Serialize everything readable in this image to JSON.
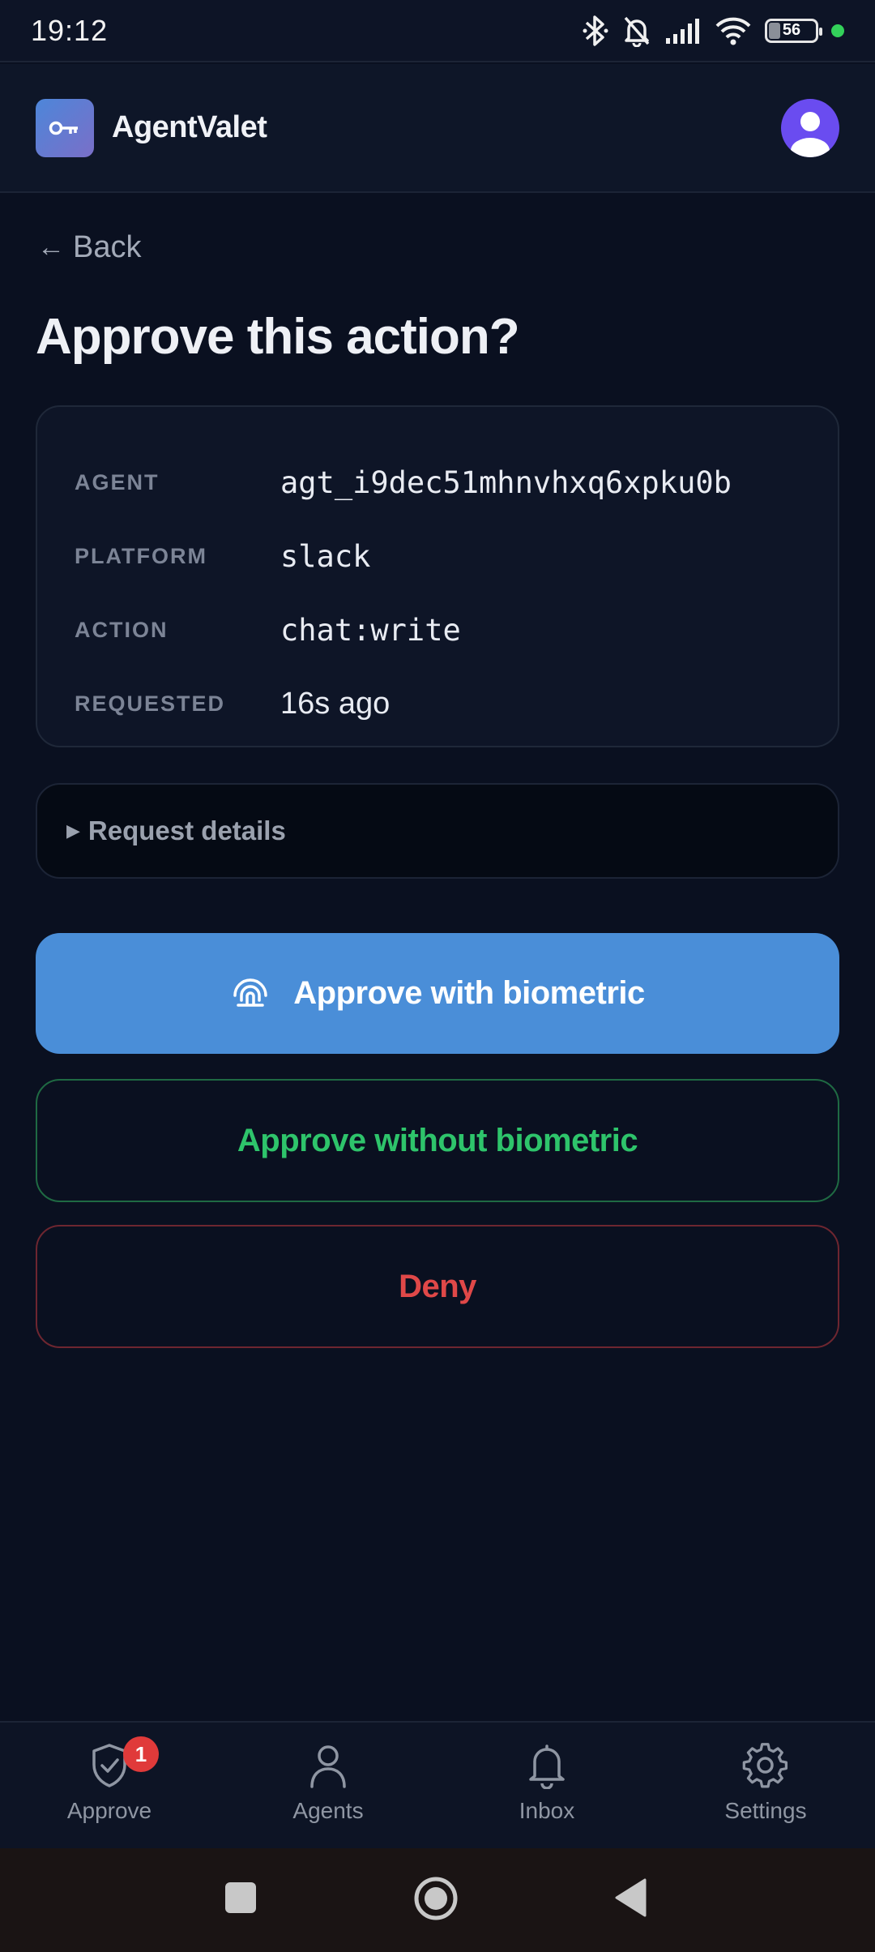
{
  "status_bar": {
    "time": "19:12",
    "battery": "56",
    "icons": [
      "bluetooth-icon",
      "bell-muted-icon",
      "signal-icon",
      "wifi-icon",
      "battery-icon",
      "dot-icon"
    ]
  },
  "header": {
    "app_name": "AgentValet",
    "logo_icon": "key-icon",
    "avatar_icon": "user-avatar-icon"
  },
  "back": {
    "arrow": "←",
    "label": "Back"
  },
  "page": {
    "title": "Approve this action?"
  },
  "request": {
    "rows": [
      {
        "label": "AGENT",
        "value": "agt_i9dec51mhnvhxq6xpku0b",
        "mono": true
      },
      {
        "label": "PLATFORM",
        "value": "slack",
        "mono": true
      },
      {
        "label": "ACTION",
        "value": "chat:write",
        "mono": true
      },
      {
        "label": "REQUESTED",
        "value": "16s ago",
        "mono": false
      }
    ]
  },
  "details": {
    "toggle": "▶",
    "label": "Request details"
  },
  "actions": {
    "approve_biometric": "Approve with biometric",
    "approve_no_biometric": "Approve without biometric",
    "deny": "Deny"
  },
  "colors": {
    "background": "#0a1020",
    "primary": "#4a8ed8",
    "success": "#2ec46b",
    "danger": "#e04848",
    "badge": "#e03a3a"
  },
  "bottom_nav": {
    "items": [
      {
        "label": "Approve",
        "icon": "shield-check-icon",
        "badge": "1"
      },
      {
        "label": "Agents",
        "icon": "person-icon"
      },
      {
        "label": "Inbox",
        "icon": "bell-icon"
      },
      {
        "label": "Settings",
        "icon": "gear-icon"
      }
    ]
  },
  "system_nav": {
    "icons": [
      "square-recents-icon",
      "circle-home-icon",
      "triangle-back-icon"
    ]
  }
}
